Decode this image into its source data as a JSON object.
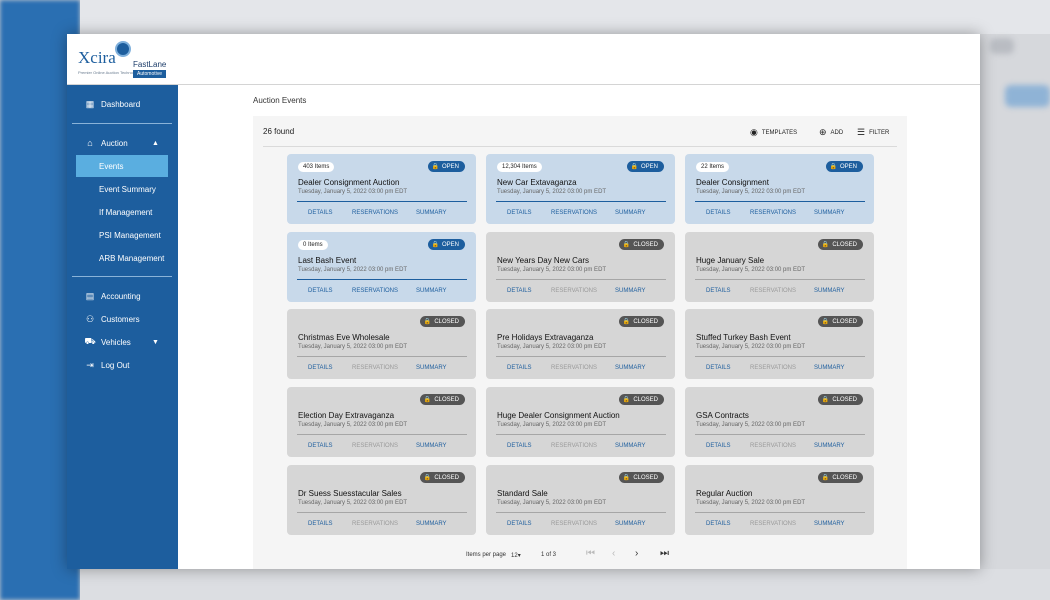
{
  "app": {
    "logo": {
      "brand": "Xcira",
      "product": "FastLane",
      "tagline": "Premier Online Auction Technologies",
      "edition": "Automotive"
    }
  },
  "sidebar": {
    "items": [
      {
        "label": "Dashboard",
        "icon": "dashboard-icon"
      },
      {
        "label": "Auction",
        "icon": "home-icon",
        "expanded": true
      },
      {
        "label": "Accounting",
        "icon": "document-icon"
      },
      {
        "label": "Customers",
        "icon": "people-icon"
      },
      {
        "label": "Vehicles",
        "icon": "car-icon"
      },
      {
        "label": "Log Out",
        "icon": "logout-icon"
      }
    ],
    "auction_sub": [
      {
        "label": "Events",
        "active": true
      },
      {
        "label": "Event Summary"
      },
      {
        "label": "If Management"
      },
      {
        "label": "PSI Management"
      },
      {
        "label": "ARB Management"
      }
    ]
  },
  "main": {
    "title": "Auction Events",
    "count": "26 found",
    "toolbar": {
      "templates": "TEMPLATES",
      "add": "ADD",
      "filter": "FILTER"
    },
    "actions": {
      "details": "DETAILS",
      "reservations": "RESERVATIONS",
      "summary": "SUMMARY"
    },
    "events": [
      {
        "items": "403 Items",
        "status": "OPEN",
        "name": "Dealer Consignment Auction",
        "date": "Tuesday, January 5, 2022 03:00 pm EDT"
      },
      {
        "items": "12,304 Items",
        "status": "OPEN",
        "name": "New Car Extavaganza",
        "date": "Tuesday, January 5, 2022 03:00 pm EDT"
      },
      {
        "items": "22 Items",
        "status": "OPEN",
        "name": "Dealer Consignment",
        "date": "Tuesday, January 5, 2022 03:00 pm EDT"
      },
      {
        "items": "0 Items",
        "status": "OPEN",
        "name": "Last Bash Event",
        "date": "Tuesday, January 5, 2022 03:00 pm EDT"
      },
      {
        "items": "",
        "status": "CLOSED",
        "name": "New Years Day New Cars",
        "date": "Tuesday, January 5, 2022 03:00 pm EDT"
      },
      {
        "items": "",
        "status": "CLOSED",
        "name": "Huge January Sale",
        "date": "Tuesday, January 5, 2022 03:00 pm EDT"
      },
      {
        "items": "",
        "status": "CLOSED",
        "name": "Christmas Eve Wholesale",
        "date": "Tuesday, January 5, 2022 03:00 pm EDT"
      },
      {
        "items": "",
        "status": "CLOSED",
        "name": "Pre Holidays Extravaganza",
        "date": "Tuesday, January 5, 2022 03:00 pm EDT"
      },
      {
        "items": "",
        "status": "CLOSED",
        "name": "Stuffed Turkey Bash Event",
        "date": "Tuesday, January 5, 2022 03:00 pm EDT"
      },
      {
        "items": "",
        "status": "CLOSED",
        "name": "Election Day Extravaganza",
        "date": "Tuesday, January 5, 2022 03:00 pm EDT"
      },
      {
        "items": "",
        "status": "CLOSED",
        "name": "Huge Dealer Consignment Auction",
        "date": "Tuesday, January 5, 2022 03:00 pm EDT"
      },
      {
        "items": "",
        "status": "CLOSED",
        "name": "GSA Contracts",
        "date": "Tuesday, January 5, 2022 03:00 pm EDT"
      },
      {
        "items": "",
        "status": "CLOSED",
        "name": "Dr Suess Suesstacular Sales",
        "date": "Tuesday, January 5, 2022 03:00 pm EDT"
      },
      {
        "items": "",
        "status": "CLOSED",
        "name": "Standard Sale",
        "date": "Tuesday, January 5, 2022 03:00 pm EDT"
      },
      {
        "items": "",
        "status": "CLOSED",
        "name": "Regular Auction",
        "date": "Tuesday, January 5, 2022 03:00 pm EDT"
      }
    ],
    "pagination": {
      "items_per_page_label": "Items per page",
      "items_per_page": "12",
      "range": "1 of 3"
    }
  },
  "colors": {
    "primary": "#1d5e9e",
    "active_nav": "#5aaee0",
    "open_card": "#c8d9ea",
    "closed_card": "#d6d6d6",
    "closed_badge": "#555555"
  }
}
